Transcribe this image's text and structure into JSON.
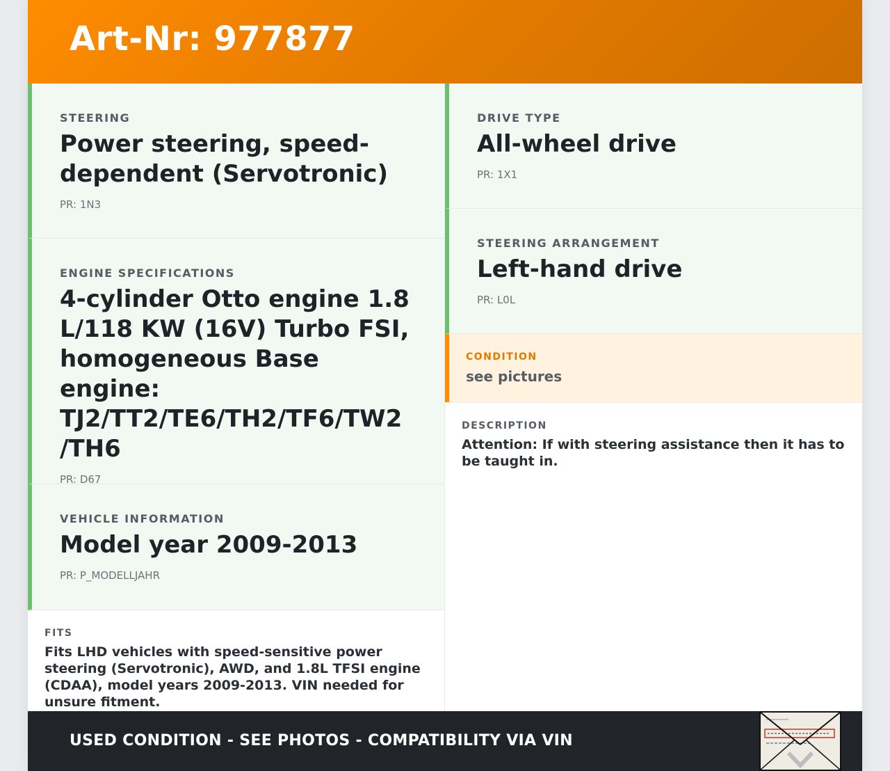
{
  "header": {
    "title": "Art-Nr: 977877"
  },
  "specs_left": [
    {
      "label": "STEERING",
      "value": "Power steering, speed-dependent (Servotronic)",
      "pr": "PR: 1N3"
    },
    {
      "label": "ENGINE SPECIFICATIONS",
      "value": "4-cylinder Otto engine 1.8 L/118 KW (16V) Turbo FSI, homogeneous Base engine: TJ2/TT2/TE6/TH2/TF6/TW2 /TH6",
      "pr": "PR: D67"
    },
    {
      "label": "VEHICLE INFORMATION",
      "value": "Model year 2009-2013",
      "pr": "PR: P_MODELLJAHR"
    }
  ],
  "specs_right": [
    {
      "label": "DRIVE TYPE",
      "value": "All-wheel drive",
      "pr": "PR: 1X1"
    },
    {
      "label": "STEERING ARRANGEMENT",
      "value": "Left-hand drive",
      "pr": "PR: L0L"
    }
  ],
  "condition": {
    "label": "CONDITION",
    "value": "see pictures"
  },
  "description": {
    "label": "DESCRIPTION",
    "text": "Attention: If with steering assistance then it has to be taught in."
  },
  "fits": {
    "label": "FITS",
    "text": "Fits LHD vehicles with speed-sensitive power steering (Servotronic), AWD, and 1.8L TFSI engine (CDAA), model years 2009-2013. VIN needed for unsure fitment."
  },
  "footer": {
    "text": "USED CONDITION - SEE PHOTOS - COMPATIBILITY VIA VIN"
  },
  "thumbnail": {
    "icon": "part-label-photo-thumbnail"
  },
  "colors": {
    "header": "#ff8c00",
    "spec_accent": "#6cc070",
    "condition_accent": "#ff8c00",
    "footer": "#212529"
  }
}
